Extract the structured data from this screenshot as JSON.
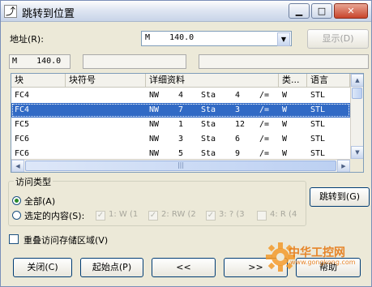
{
  "window": {
    "title": "跳转到位置",
    "icon": "jump-app-icon",
    "title_buttons": [
      "?",
      "□",
      "✕"
    ]
  },
  "address": {
    "label": "地址(R):",
    "value": "M    140.0",
    "show_button": "显示(D)"
  },
  "status": {
    "field1": "M    140.0",
    "field2": "",
    "field3": ""
  },
  "table": {
    "headers": [
      "块",
      "块符号",
      "详细资料",
      "类...",
      "语言"
    ],
    "rows": [
      {
        "block": "FC4",
        "symbol": "",
        "c1": "NW",
        "c2": "4",
        "c3": "Sta",
        "c4": "4",
        "c5": "/=",
        "type": "W",
        "lang": "STL",
        "selected": false
      },
      {
        "block": "FC4",
        "symbol": "",
        "c1": "NW",
        "c2": "7",
        "c3": "Sta",
        "c4": "3",
        "c5": "/=",
        "type": "W",
        "lang": "STL",
        "selected": true
      },
      {
        "block": "FC5",
        "symbol": "",
        "c1": "NW",
        "c2": "1",
        "c3": "Sta",
        "c4": "12",
        "c5": "/=",
        "type": "W",
        "lang": "STL",
        "selected": false
      },
      {
        "block": "FC6",
        "symbol": "",
        "c1": "NW",
        "c2": "3",
        "c3": "Sta",
        "c4": "6",
        "c5": "/=",
        "type": "W",
        "lang": "STL",
        "selected": false
      },
      {
        "block": "FC6",
        "symbol": "",
        "c1": "NW",
        "c2": "5",
        "c3": "Sta",
        "c4": "9",
        "c5": "/=",
        "type": "W",
        "lang": "STL",
        "selected": false
      }
    ]
  },
  "access": {
    "group_label": "访问类型",
    "all_label": "全部(A)",
    "selected_label": "选定的内容(S):",
    "options": [
      "1: W (1",
      "2: RW (2",
      "3: ? (3",
      "4: R (4"
    ],
    "options_checked": [
      true,
      true,
      true,
      false
    ],
    "jump_button": "跳转到(G)"
  },
  "overlap": {
    "label": "重叠访问存储区域(V)",
    "checked": false
  },
  "footer": {
    "close": "关闭(C)",
    "start": "起始点(P)",
    "prev": "<<",
    "next": ">>",
    "help": "帮助"
  },
  "watermark": {
    "site": "中华工控网",
    "url": "www.gongkong.com"
  },
  "colors": {
    "selection": "#316ac5",
    "dialog_bg": "#ece9d8",
    "watermark": "#e67a16"
  }
}
